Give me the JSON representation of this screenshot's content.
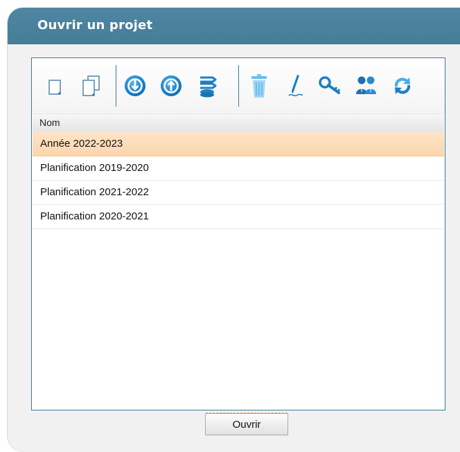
{
  "dialog": {
    "title": "Ouvrir un projet"
  },
  "toolbar": {
    "buttons": [
      {
        "name": "new-project-icon"
      },
      {
        "name": "duplicate-project-icon"
      },
      {
        "name": "import-icon"
      },
      {
        "name": "export-icon"
      },
      {
        "name": "merge-icon"
      },
      {
        "name": "delete-icon"
      },
      {
        "name": "rename-icon"
      },
      {
        "name": "key-icon"
      },
      {
        "name": "users-icon"
      },
      {
        "name": "refresh-icon"
      }
    ]
  },
  "list": {
    "column_header": "Nom",
    "rows": [
      {
        "label": "Année 2022-2023",
        "selected": true
      },
      {
        "label": "Planification 2019-2020",
        "selected": false
      },
      {
        "label": "Planification 2021-2022",
        "selected": false
      },
      {
        "label": "Planification 2020-2021",
        "selected": false
      }
    ]
  },
  "footer": {
    "open_label": "Ouvrir"
  },
  "colors": {
    "titlebar": "#4e86a2",
    "accent_blue": "#1e7fc2",
    "selected_row": "#fcd6ad"
  }
}
